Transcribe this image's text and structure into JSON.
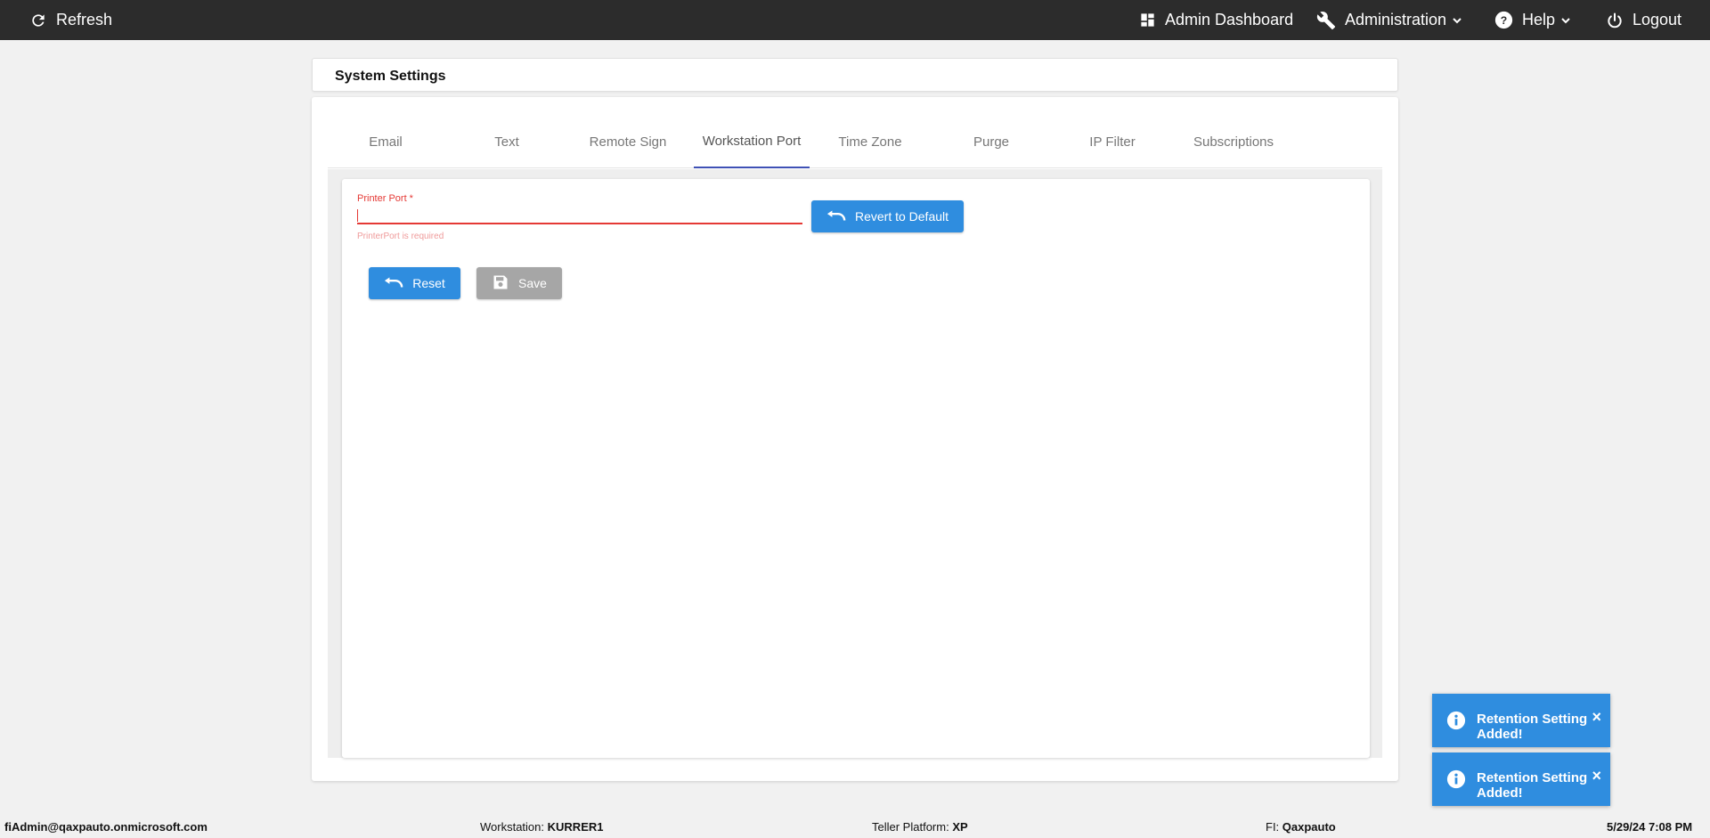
{
  "topbar": {
    "refresh_label": "Refresh",
    "admin_dashboard_label": "Admin Dashboard",
    "administration_label": "Administration",
    "help_label": "Help",
    "logout_label": "Logout"
  },
  "header": {
    "title": "System Settings"
  },
  "tabs": [
    {
      "label": "Email"
    },
    {
      "label": "Text"
    },
    {
      "label": "Remote Sign"
    },
    {
      "label": "Workstation Port",
      "active": true
    },
    {
      "label": "Time Zone"
    },
    {
      "label": "Purge"
    },
    {
      "label": "IP Filter"
    },
    {
      "label": "Subscriptions"
    }
  ],
  "form": {
    "printer_port_label": "Printer Port *",
    "printer_port_value": "",
    "printer_port_error": "PrinterPort is required",
    "revert_label": "Revert to Default",
    "reset_label": "Reset",
    "save_label": "Save"
  },
  "toasts": [
    {
      "message": "Retention Setting Added!",
      "close": "×"
    },
    {
      "message": "Retention Setting Added!",
      "close": "×"
    }
  ],
  "status": {
    "user": "fiAdmin@qaxpauto.onmicrosoft.com",
    "workstation_label": "Workstation:",
    "workstation_value": "KURRER1",
    "teller_label": "Teller Platform:",
    "teller_value": "XP",
    "fi_label": "FI:",
    "fi_value": "Qaxpauto",
    "datetime": "5/29/24 7:08 PM"
  },
  "colors": {
    "topbar": "#2c2c2c",
    "primary": "#2f8ddf",
    "error": "#e53935",
    "tab_indicator": "#3f51b5"
  },
  "icons": [
    "refresh-icon",
    "dashboard-icon",
    "wrench-icon",
    "help-icon",
    "power-icon",
    "chevron-down-icon",
    "undo-icon",
    "save-icon",
    "info-icon",
    "close-icon"
  ]
}
